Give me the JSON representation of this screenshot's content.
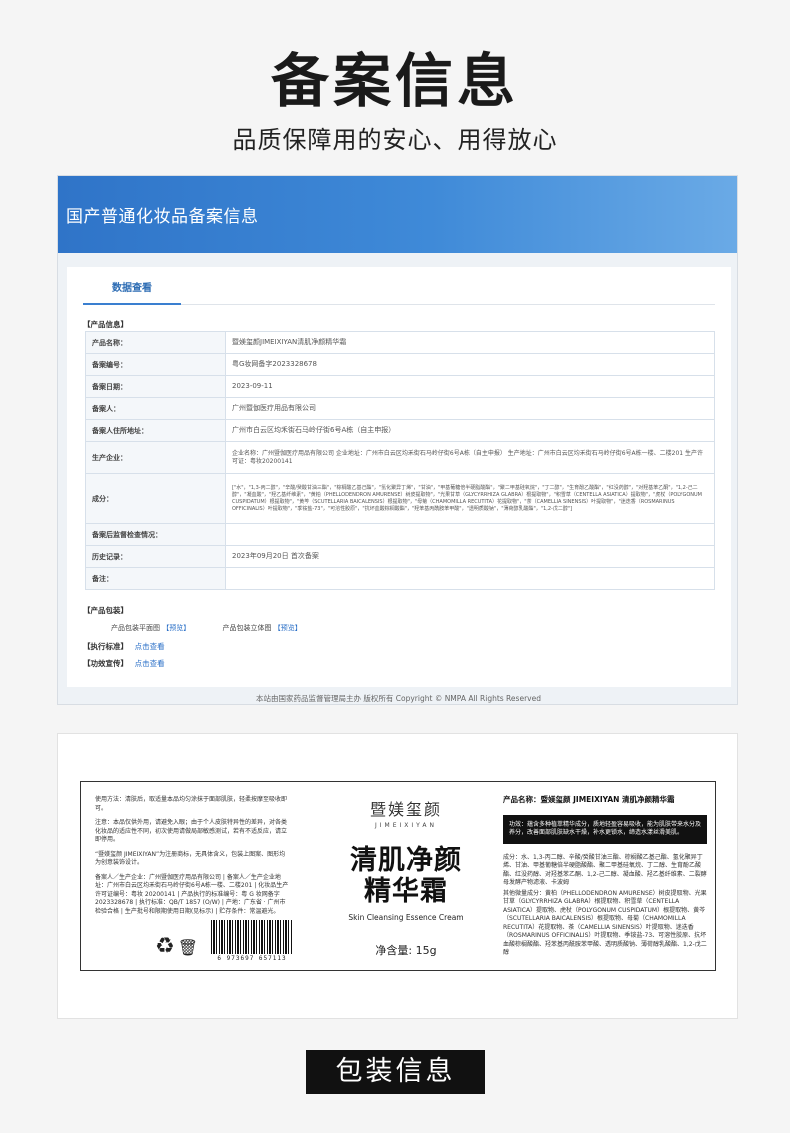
{
  "hero": {
    "title": "备案信息",
    "subtitle": "品质保障用的安心、用得放心"
  },
  "registration": {
    "banner_title": "国产普通化妆品备案信息",
    "tab": "数据查看",
    "product_info_label": "【产品信息】",
    "rows": [
      {
        "key": "产品名称：",
        "value": "暨媄玺颜JIMEIXIYAN清肌净颜精华霜"
      },
      {
        "key": "备案编号：",
        "value": "粤G妆网备字2023328678"
      },
      {
        "key": "备案日期：",
        "value": "2023-09-11"
      },
      {
        "key": "备案人：",
        "value": "广州暨伽医疗用品有限公司"
      },
      {
        "key": "备案人住所地址：",
        "value": "广州市白云区均禾街石马岭仔街6号A栋（自主申报）"
      },
      {
        "key": "生产企业：",
        "value": "企业名称：广州暨伽医疗用品有限公司 企业地址：广州市白云区均禾街石马岭仔街6号A栋（自主申报） 生产地址：广州市白云区均禾街石马岭仔街6号A栋一楼、二楼201 生产许可证：粤妆20200141"
      },
      {
        "key": "成分：",
        "value": "[\"水\"，\"1,3-丙二醇\"，\"辛酸/癸酸甘油三酯\"，\"棕榈酸乙基己酯\"，\"氢化聚异丁烯\"，\"甘油\"，\"甲基葡糖倍半硬脂酸酯\"，\"聚二甲基硅氧烷\"，\"丁二醇\"，\"生育酚乙酸酯\"，\"红没药醇\"，\"对羟基苯乙酮\"，\"1,2-己二醇\"，\"凝血酸\"，\"羟乙基纤维素\"，\"黄柏（PHELLODENDRON AMURENSE）树皮提取物\"，\"光果甘草（GLYCYRRHIZA GLABRA）根提取物\"，\"积雪草（CENTELLA ASIATICA）提取物\"，\"虎杖（POLYGONUM CUSPIDATUM）根提取物\"，\"黄芩（SCUTELLARIA BAICALENSIS）根提取物\"，\"母菊（CHAMOMILLA RECUTITA）花提取物\"，\"茶（CAMELLIA SINENSIS）叶提取物\"，\"迷迭香（ROSMARINUS OFFICINALIS）叶提取物\"，\"季铵盐-73\"，\"可溶性胶原\"，\"抗坏血酸棕榈酸酯\"，\"羟苯基丙酰胺苯甲酸\"，\"透明质酸钠\"，\"薄荷醇乳酸酯\"，\"1,2-戊二醇\"]"
      },
      {
        "key": "备案后监督检查情况：",
        "value": ""
      },
      {
        "key": "历史记录：",
        "value": "2023年09月20日 首次备案"
      },
      {
        "key": "备注：",
        "value": ""
      }
    ],
    "packaging_label": "【产品包装】",
    "pkg_flat": "产品包装平面图",
    "pkg_3d": "产品包装立体图",
    "preview_link": "【预览】",
    "standard_label": "【执行标准】",
    "efficacy_label": "【功效宣传】",
    "click_view": "点击查看",
    "footer": "本站由国家药品监督管理局主办 版权所有 Copyright © NMPA All Rights Reserved"
  },
  "label": {
    "col1_usage": "使用方法：清肤后，取适量本品均匀涂抹于面部肌肤，轻柔按摩至吸收即可。",
    "col1_note": "注意：本品仅供外用，请避免入眼；由于个人皮肤特异性的差异，对各类化妆品的适应性不同，初次使用请做局部敏感测试，若有不适反应，请立即停用。",
    "col1_trademark": "“暨媄玺颜 JIMEIXIYAN”为注册商标，无具体含义，包装上图案、图形均为创意装饰设计。",
    "col1_company": "备案人／生产企业：广州暨伽医疗用品有限公司 | 备案人／生产企业地址：广州市白云区均禾街石马岭仔街6号A栋一楼、二楼201 | 化妆品生产许可证编号：粤妆 20200141 | 产品执行的标准编号：粤 G 妆网备字 2023328678 | 执行标准：QB/T 1857 (O/W) | 产地：广东省 · 广州市　检验合格 | 生产批号和限期使用日期(见标示) | 贮存条件：常温避光。",
    "barcode_number": "6 973697 657113",
    "brand_cn": "暨媄玺颜",
    "brand_en": "JIMEIXIYAN",
    "product_cn_line1": "清肌净颜",
    "product_cn_line2": "精华霜",
    "product_en": "Skin Cleansing Essence Cream",
    "net_weight": "净含量: 15g",
    "col3_name": "产品名称：暨媄玺颜 JIMEIXIYAN 清肌净颜精华霜",
    "col3_effect": "功效：蕴含多种植萃精华成分，质地轻盈容易吸收，能为肌肤带来水分及养分，改善面部肌肤缺水干燥，补水更锁水，缔造水漾丝滑美肌。",
    "col3_ingredients": "成分：水、1,3-丙二醇、辛酸/癸酸甘油三酯、棕榈酸乙基己酯、氢化聚异丁烯、甘油、甲基葡糖倍半硬脂酸酯、聚二甲基硅氧烷、丁二醇、生育酚乙酸酯、红没药醇、对羟基苯乙酮、1,2-己二醇、凝血酸、羟乙基纤维素、二裂酵母发酵产物滤液、卡波姆",
    "col3_others": "其他微量成分：黄柏（PHELLODENDRON AMURENSE）树皮提取物、光果甘草（GLYCYRRHIZA GLABRA）根提取物、积雪草（CENTELLA ASIATICA）提取物、虎杖（POLYGONUM CUSPIDATUM）根提取物、黄芩（SCUTELLARIA BAICALENSIS）根提取物、母菊（CHAMOMILLA RECUTITA）花提取物、茶（CAMELLIA SINENSIS）叶提取物、迷迭香（ROSMARINUS OFFICINALIS）叶提取物、季铵盐-73、可溶性胶原、抗坏血酸棕榈酸酯、羟苯基丙酰胺苯甲酸、透明质酸钠、薄荷醇乳酸酯、1,2-戊二醇"
  },
  "packaging_title": "包装信息"
}
